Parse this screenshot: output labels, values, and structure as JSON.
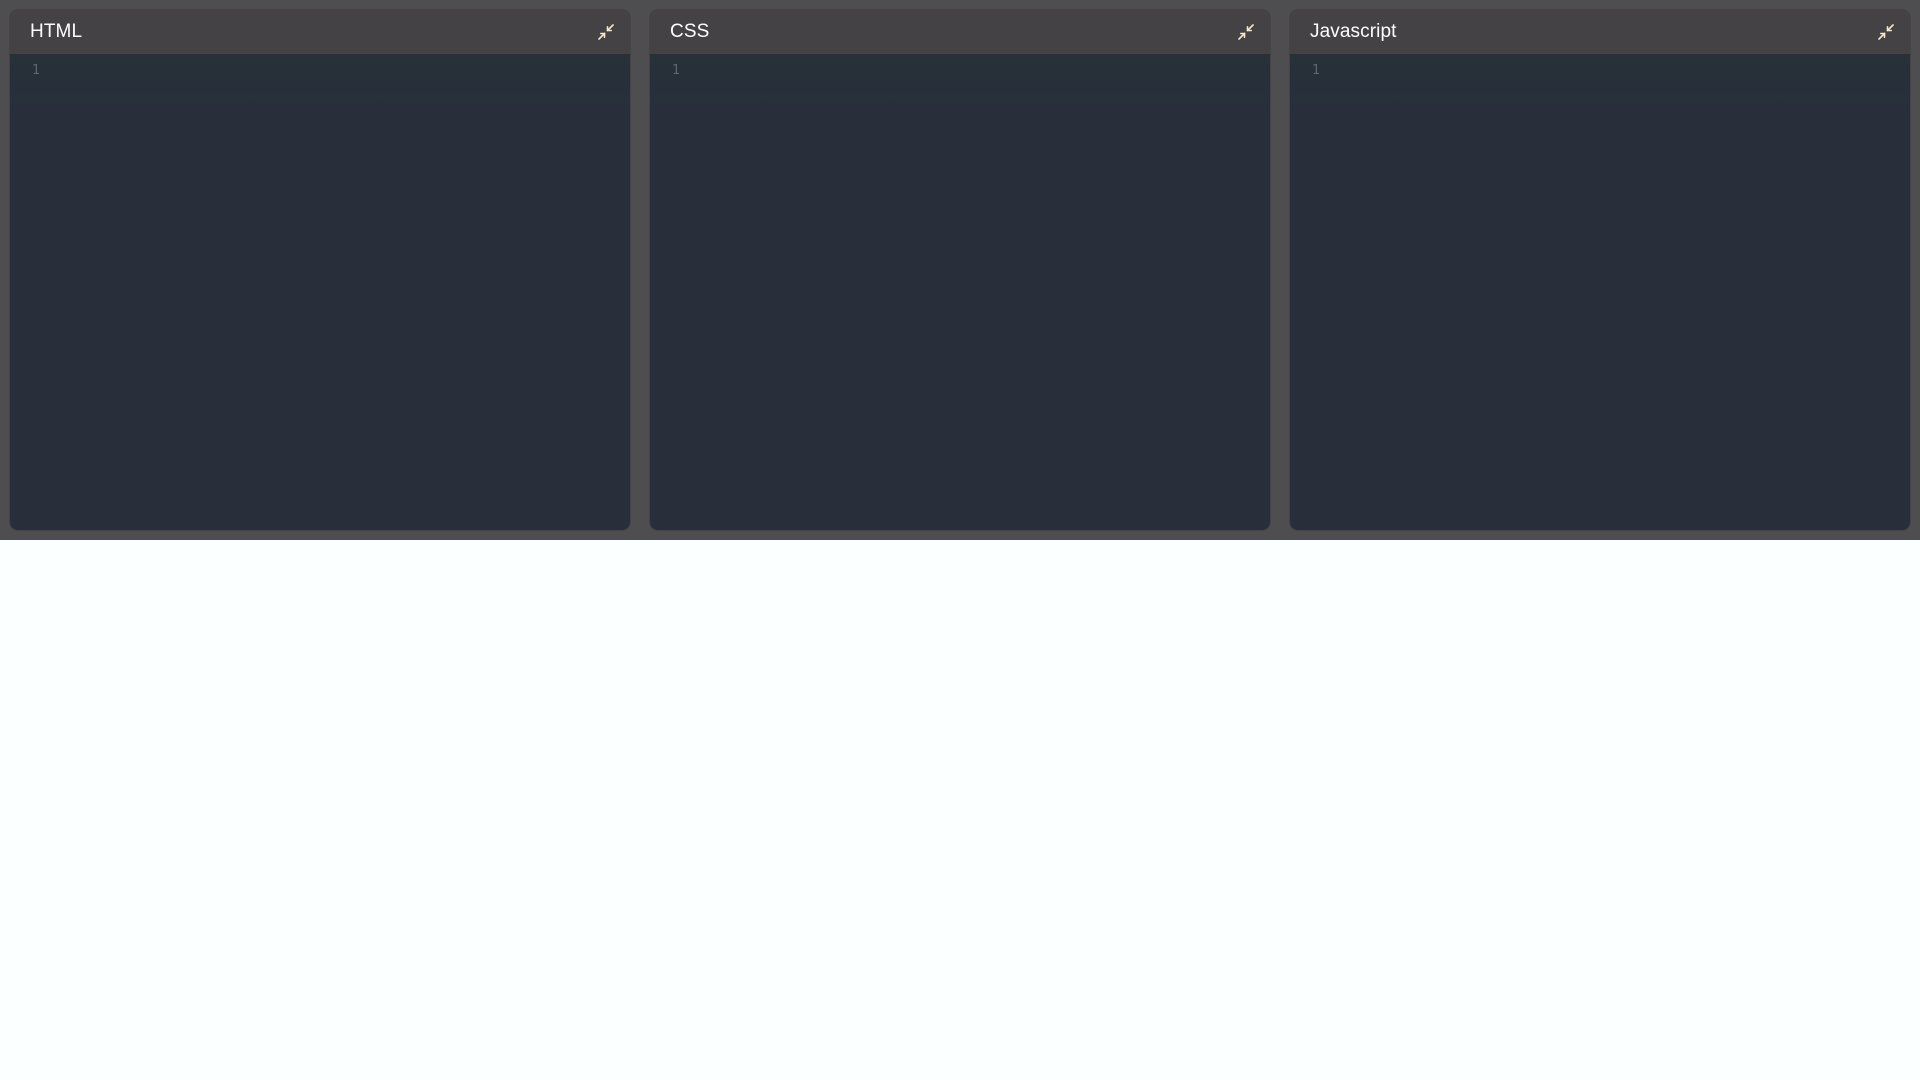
{
  "editors": [
    {
      "title": "HTML",
      "line_number": "1",
      "minimize_icon": "minimize-arrows-icon"
    },
    {
      "title": "CSS",
      "line_number": "1",
      "minimize_icon": "minimize-arrows-icon"
    },
    {
      "title": "Javascript",
      "line_number": "1",
      "minimize_icon": "minimize-arrows-icon"
    }
  ],
  "colors": {
    "page_background": "#fbffff",
    "editors_bar_background": "#4e4e51",
    "panel_header_background": "#444244",
    "editor_background": "#282f3b",
    "icon_color": "#f2e9c6"
  }
}
